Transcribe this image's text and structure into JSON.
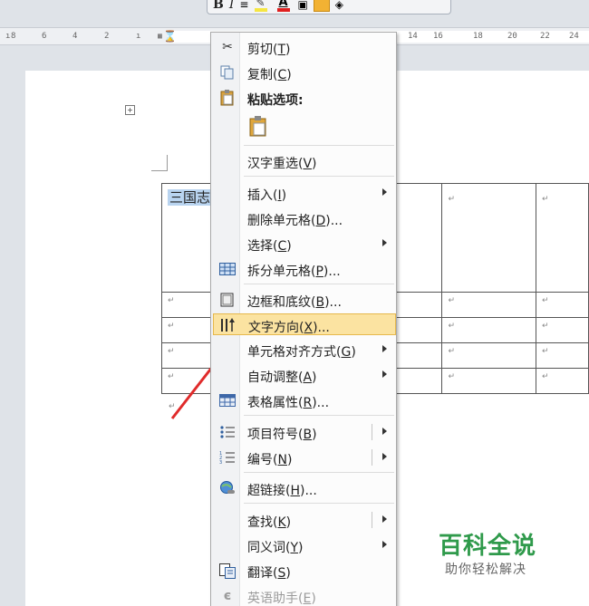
{
  "mini_toolbar": {
    "bold": "B",
    "italic": "I",
    "highlight_color": "#f5e642",
    "font_color": "#e01f1f",
    "accent_color": "#f2b233"
  },
  "ruler": {
    "ticks_left": [
      "8",
      "6",
      "4",
      "2"
    ],
    "ticks_right": [
      "14",
      "16",
      "18",
      "20",
      "22",
      "24"
    ]
  },
  "table": {
    "rows": [
      [
        "三国志",
        "↵",
        "↵"
      ],
      [
        "↵",
        "↵",
        "↵"
      ],
      [
        "↵",
        "↵",
        "↵"
      ],
      [
        "↵",
        "↵",
        "↵"
      ],
      [
        "↵",
        "↵",
        "↵"
      ]
    ],
    "after_mark": "↵"
  },
  "context_menu": {
    "items": [
      {
        "label": "剪切",
        "key": "T",
        "icon": "scissors-icon"
      },
      {
        "label": "复制",
        "key": "C",
        "icon": "copy-icon"
      },
      {
        "label": "粘贴选项:",
        "key": "",
        "icon": "paste-icon"
      },
      {
        "label": "汉字重选",
        "key": "V",
        "icon": ""
      },
      {
        "label": "插入",
        "key": "I",
        "icon": "",
        "submenu": true
      },
      {
        "label": "删除单元格",
        "key": "D",
        "icon": "",
        "suffix": "..."
      },
      {
        "label": "选择",
        "key": "C",
        "icon": "",
        "submenu": true
      },
      {
        "label": "拆分单元格",
        "key": "P",
        "icon": "split-cells-icon",
        "suffix": "..."
      },
      {
        "label": "边框和底纹",
        "key": "B",
        "icon": "borders-icon",
        "suffix": "..."
      },
      {
        "label": "文字方向",
        "key": "X",
        "icon": "text-direction-icon",
        "suffix": "...",
        "highlighted": true
      },
      {
        "label": "单元格对齐方式",
        "key": "G",
        "icon": "",
        "submenu": true
      },
      {
        "label": "自动调整",
        "key": "A",
        "icon": "",
        "submenu": true
      },
      {
        "label": "表格属性",
        "key": "R",
        "icon": "table-properties-icon",
        "suffix": "..."
      },
      {
        "label": "项目符号",
        "key": "B",
        "icon": "bullets-icon",
        "submenu": true
      },
      {
        "label": "编号",
        "key": "N",
        "icon": "numbering-icon",
        "submenu": true
      },
      {
        "label": "超链接",
        "key": "H",
        "icon": "hyperlink-icon",
        "suffix": "..."
      },
      {
        "label": "查找",
        "key": "K",
        "icon": "",
        "submenu": true
      },
      {
        "label": "同义词",
        "key": "Y",
        "icon": "",
        "submenu": true
      },
      {
        "label": "翻译",
        "key": "S",
        "icon": "translate-icon"
      },
      {
        "label": "英语助手",
        "key": "E",
        "icon": "english-assistant-icon",
        "disabled": true
      }
    ]
  },
  "watermark": {
    "title": "百科全说",
    "subtitle": "助你轻松解决"
  }
}
